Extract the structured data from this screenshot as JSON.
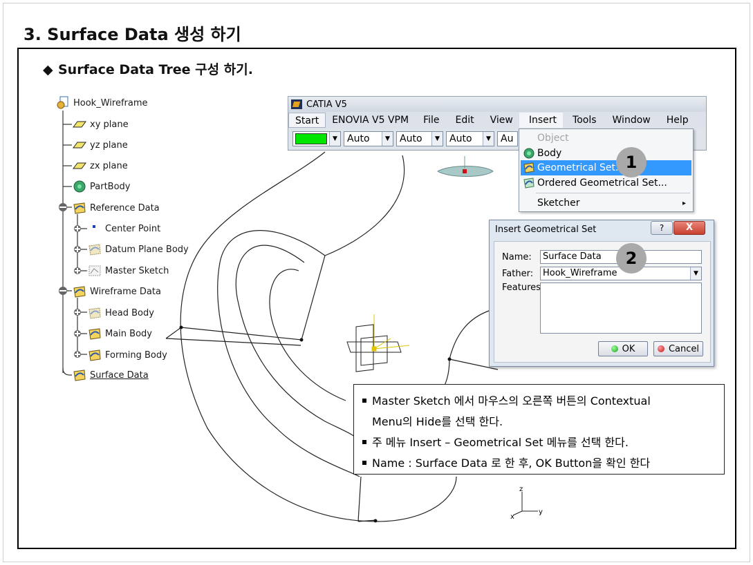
{
  "slide": {
    "title": "3. Surface Data 생성 하기",
    "subtitle": "Surface Data Tree 구성 하기.",
    "subtitle_bullet": "◆"
  },
  "tree": {
    "root": "Hook_Wireframe",
    "items": [
      {
        "label": "xy plane",
        "icon": "plane-icon"
      },
      {
        "label": "yz plane",
        "icon": "plane-icon"
      },
      {
        "label": "zx plane",
        "icon": "plane-icon"
      },
      {
        "label": "PartBody",
        "icon": "partbody-icon"
      },
      {
        "label": "Reference Data",
        "icon": "geometrical-set-icon"
      },
      {
        "label": "Center Point",
        "icon": "point-icon"
      },
      {
        "label": "Datum Plane Body",
        "icon": "hidden-geometrical-set-icon"
      },
      {
        "label": "Master Sketch",
        "icon": "hidden-sketch-icon"
      },
      {
        "label": "Wireframe Data",
        "icon": "geometrical-set-icon"
      },
      {
        "label": "Head Body",
        "icon": "hidden-geometrical-set-icon"
      },
      {
        "label": "Main Body",
        "icon": "geometrical-set-icon"
      },
      {
        "label": "Forming Body",
        "icon": "geometrical-set-icon"
      },
      {
        "label": "Surface Data",
        "icon": "geometrical-set-icon"
      }
    ]
  },
  "catia": {
    "title": "CATIA V5",
    "menus": [
      "Start",
      "ENOVIA V5 VPM",
      "File",
      "Edit",
      "View",
      "Insert",
      "Tools",
      "Window",
      "Help"
    ],
    "color_swatch": "#00e600",
    "combos": [
      "Auto",
      "Auto",
      "Auto",
      "Au"
    ]
  },
  "insert_menu": {
    "items": [
      {
        "label": "Object",
        "disabled": true
      },
      {
        "label": "Body"
      },
      {
        "label": "Geometrical Set...",
        "highlighted": true
      },
      {
        "label": "Ordered Geometrical Set..."
      },
      {
        "label": "Sketcher",
        "submenu": true
      }
    ],
    "submenu_arrow": "▸"
  },
  "steps": [
    "1",
    "2"
  ],
  "dialog": {
    "title": "Insert Geometrical Set",
    "help_label": "?",
    "close_label": "X",
    "name_label": "Name:",
    "name_value": "Surface Data",
    "father_label": "Father:",
    "father_value": "Hook_Wireframe",
    "features_label": "Features:",
    "ok_label": "OK",
    "cancel_label": "Cancel"
  },
  "note": {
    "lines": [
      "Master Sketch 에서 마우스의 오른쪽 버튼의 Contextual",
      "Menu의 Hide를 선택 한다.",
      "주 메뉴 Insert – Geometrical Set 메뉴를 선택 한다.",
      "Name : Surface Data 로 한 후, OK Button을 확인 한다"
    ]
  },
  "axis_labels": {
    "z": "z",
    "y": "y",
    "x": "x"
  }
}
